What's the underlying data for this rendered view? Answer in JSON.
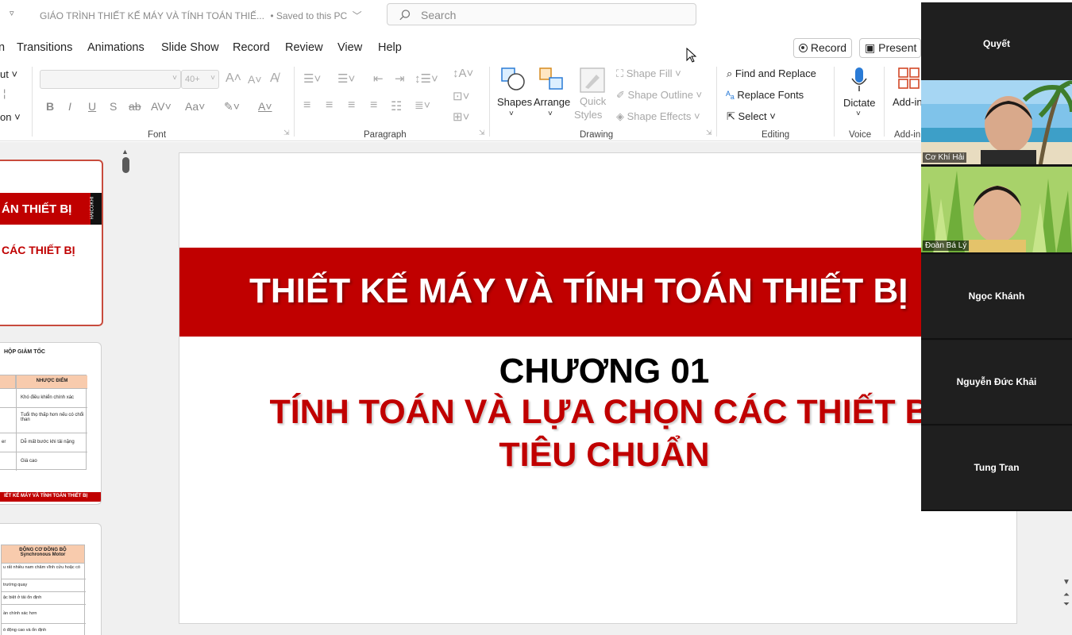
{
  "titlebar": {
    "title": "GIÁO TRÌNH THIẾT KẾ MÁY VÀ TÍNH TOÁN THIẾ...",
    "save_status": "• Saved to this PC",
    "search_placeholder": "Search"
  },
  "tabs": [
    "n",
    "Transitions",
    "Animations",
    "Slide Show",
    "Record",
    "Review",
    "View",
    "Help"
  ],
  "header_buttons": {
    "record": "Record",
    "present": "Present i"
  },
  "ribbon": {
    "clipboard": {
      "cut": "ut",
      "section": "on"
    },
    "font": {
      "size_placeholder": "40+",
      "group_label": "Font"
    },
    "paragraph": {
      "group_label": "Paragraph"
    },
    "drawing": {
      "shapes": "Shapes",
      "arrange": "Arrange",
      "quick_styles_1": "Quick",
      "quick_styles_2": "Styles",
      "shape_fill": "Shape Fill",
      "shape_outline": "Shape Outline",
      "shape_effects": "Shape Effects",
      "group_label": "Drawing"
    },
    "editing": {
      "find_replace": "Find and Replace",
      "replace_fonts": "Replace Fonts",
      "select": "Select",
      "group_label": "Editing"
    },
    "voice": {
      "dictate": "Dictate",
      "group_label": "Voice"
    },
    "addins": {
      "addin": "Add-in",
      "group_label": "Add-in"
    }
  },
  "thumbnails": {
    "t1_line1": "ÁN THIẾT BỊ",
    "t1_line2": "CÁC THIẾT BỊ",
    "t1_logo": "HAICOKHI",
    "t2_title": "HỘP GIẢM TỐC",
    "t2_header": "NHƯỢC ĐIỂM",
    "t2_rows": [
      "Khó điều khiển chính xác",
      "Tuổi thọ thấp hơn nếu có chổi than",
      "Dễ mất bước khi tải nặng",
      "Giá cao"
    ],
    "t2_row3_left": "er",
    "t2_footer": "IẾT KẾ MÁY VÀ TÍNH TOÁN THIẾT BỊ",
    "t3_header_1": "ĐỘNG CƠ ĐỒNG BỘ",
    "t3_header_2": "Synchronous Motor",
    "t3_rows": [
      "u rất nhiều nam châm vĩnh cửu hoặc có",
      "trường quay",
      "ặc biệt ở tải ổn định",
      "ần chính xác hơn",
      "ó động cao và ổn định"
    ]
  },
  "slide": {
    "banner_title": "THIẾT KẾ MÁY VÀ TÍNH TOÁN THIẾT BỊ",
    "chapter": "CHƯƠNG 01",
    "subtitle_line1": "TÍNH TOÁN VÀ LỰA CHỌN CÁC THIẾT BỊ",
    "subtitle_line2": "TIÊU CHUẨN",
    "banner_color": "#c00000",
    "text_color": "#c00000"
  },
  "participants": [
    {
      "name": "Quyết",
      "video": false
    },
    {
      "name": "Cơ Khí Hải",
      "video": true
    },
    {
      "name": "Đoàn Bá Lý",
      "video": true
    },
    {
      "name": "Ngọc Khánh",
      "video": false
    },
    {
      "name": "Nguyễn Đức Khải",
      "video": false
    },
    {
      "name": "Tung Tran",
      "video": false
    }
  ]
}
